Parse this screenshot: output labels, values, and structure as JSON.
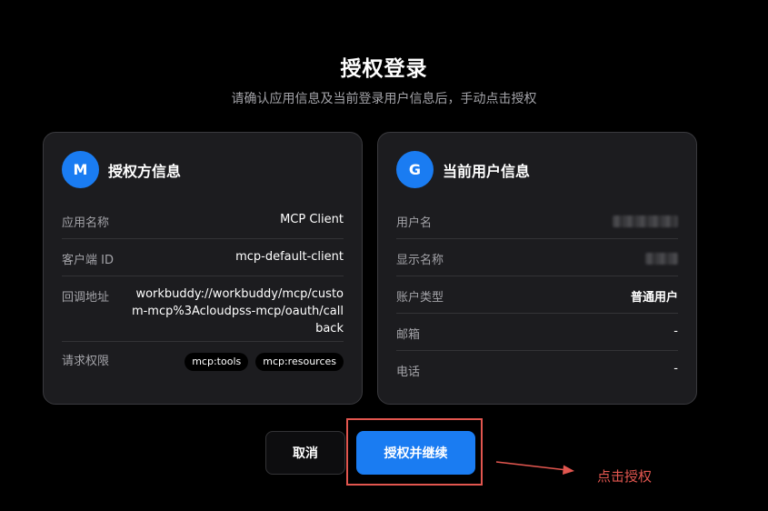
{
  "header": {
    "title": "授权登录",
    "subtitle": "请确认应用信息及当前登录用户信息后，手动点击授权"
  },
  "client_card": {
    "avatar": "M",
    "title": "授权方信息",
    "app_name_label": "应用名称",
    "app_name_value": "MCP Client",
    "client_id_label": "客户端 ID",
    "client_id_value": "mcp-default-client",
    "callback_label": "回调地址",
    "callback_value": "workbuddy://workbuddy/mcp/custom-mcp%3Acloudpss-mcp/oauth/callback",
    "scope_label": "请求权限",
    "scopes": [
      "mcp:tools",
      "mcp:resources"
    ]
  },
  "user_card": {
    "avatar": "G",
    "title": "当前用户信息",
    "username_label": "用户名",
    "display_name_label": "显示名称",
    "account_type_label": "账户类型",
    "account_type_value": "普通用户",
    "email_label": "邮箱",
    "email_value": "-",
    "phone_label": "电话",
    "phone_value": "-"
  },
  "actions": {
    "cancel_label": "取消",
    "authorize_label": "授权并继续"
  },
  "annotation": {
    "text": "点击授权",
    "color": "#e2564f"
  },
  "colors": {
    "accent": "#1a7cf2",
    "background": "#000000",
    "card": "#1c1c1f"
  }
}
